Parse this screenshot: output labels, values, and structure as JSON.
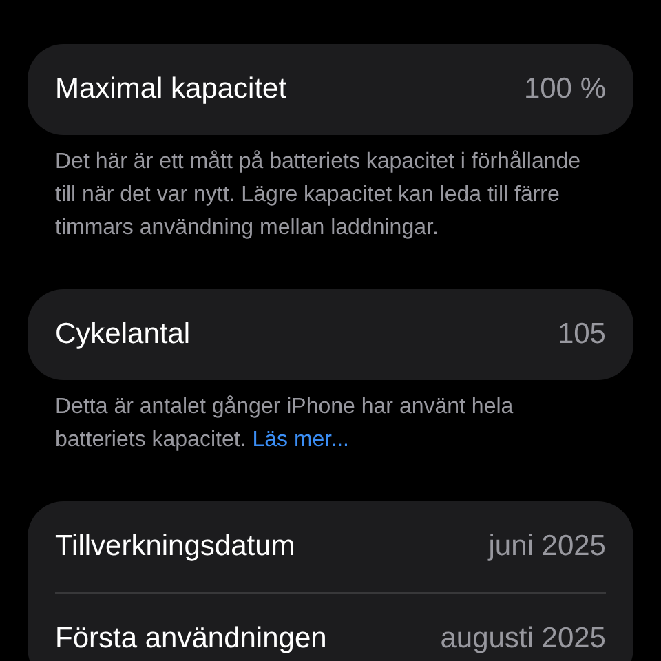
{
  "sections": [
    {
      "rows": [
        {
          "label": "Maximal kapacitet",
          "value": "100 %"
        }
      ],
      "footer": "Det här är ett mått på batteriets kapacitet i förhållande till när det var nytt. Lägre kapacitet kan leda till färre timmars användning mellan laddningar."
    },
    {
      "rows": [
        {
          "label": "Cykelantal",
          "value": "105"
        }
      ],
      "footer": "Detta är antalet gånger iPhone har använt hela batteriets kapacitet.",
      "footer_link": "Läs mer..."
    },
    {
      "rows": [
        {
          "label": "Tillverkningsdatum",
          "value": "juni 2025"
        },
        {
          "label": "Första användningen",
          "value": "augusti 2025"
        }
      ]
    }
  ]
}
